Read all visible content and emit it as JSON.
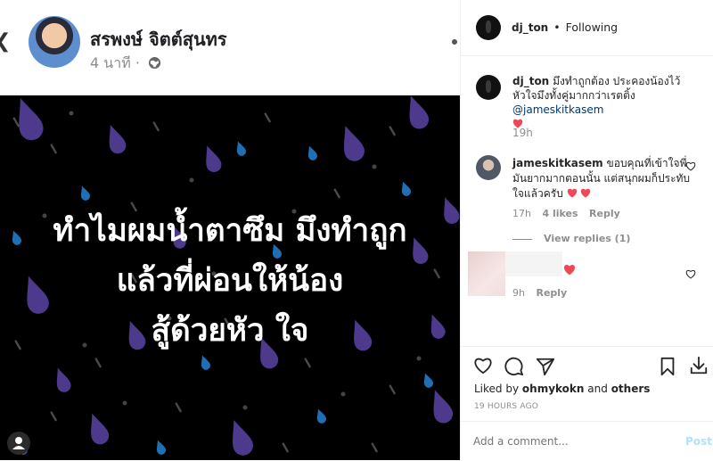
{
  "facebook_post": {
    "author": "สรพงษ์ จิตต์สุนทร",
    "time": "4 นาที",
    "meta_separator": "·",
    "quote_lines": [
      "ทำไมผมน้ำตาซึม มึงทำถูก",
      "แล้วที่ผ่อนให้น้อง",
      "สู้ด้วยหัว ใจ"
    ]
  },
  "instagram": {
    "header": {
      "username": "dj_ton",
      "separator": "•",
      "follow_status": "Following"
    },
    "caption": {
      "username": "dj_ton",
      "text": "มึงทำถูกต้อง ประคองน้องไว้ หัวใจมึงทั้งคู่มากกว่าเรตติ้ง",
      "mention": "@jameskitkasem",
      "age": "19h"
    },
    "comments": [
      {
        "username": "jameskitkasem",
        "text": "ขอบคุณที่เข้าใจพี่ มันยากมากตอนนั้น แต่สนุกผมก็ประทับใจแล้วครับ",
        "age": "17h",
        "likes": "4 likes",
        "reply": "Reply",
        "view_replies": "View replies (1)"
      },
      {
        "username": "",
        "text": "",
        "age": "9h",
        "reply": "Reply"
      }
    ],
    "liked_by": {
      "prefix": "Liked by",
      "user": "ohmykokn",
      "conj": "and",
      "others": "others"
    },
    "timestamp": "19 HOURS AGO",
    "comment_input": {
      "placeholder": "Add a comment...",
      "post_label": "Post"
    },
    "colors": {
      "heart": "#ed4956",
      "link": "#00376b",
      "post_disabled": "#b2dffc"
    }
  }
}
